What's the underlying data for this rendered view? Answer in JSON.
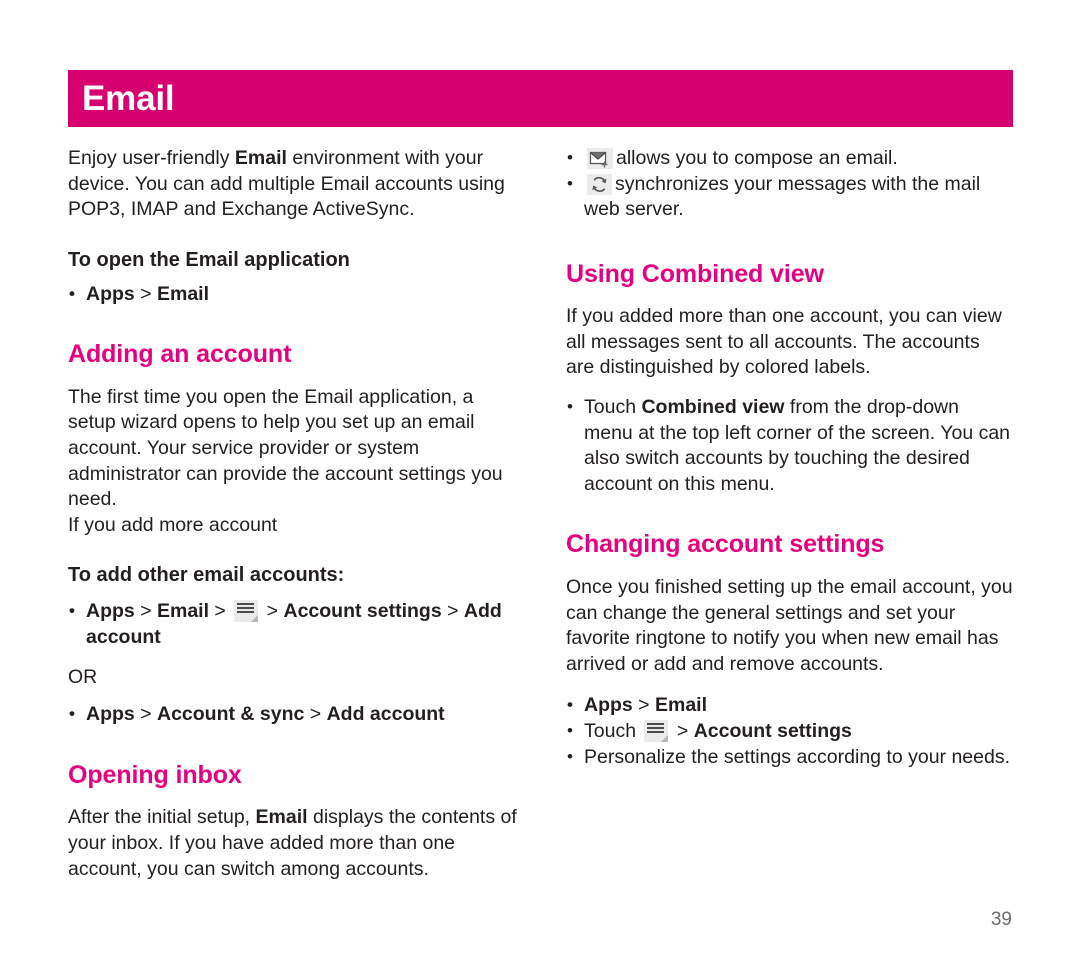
{
  "document": {
    "page_number": "39",
    "accent_band_color": "#d6006e",
    "heading_color": "#e5007e",
    "body_color": "#231f20"
  },
  "header": {
    "title": "Email"
  },
  "left_column": {
    "intro_paragraph": "Enjoy user-friendly Email environment with your device. You can add multiple Email accounts using POP3, IMAP and Exchange ActiveSync.",
    "intro_parts": {
      "p1": "Enjoy user-friendly ",
      "bold1": "Email",
      "p2": " environment with your device. You can add multiple Email accounts using POP3, IMAP and Exchange ActiveSync."
    },
    "open_app": {
      "subhead": "To open the Email application",
      "bullet": {
        "apps": "Apps",
        "sep": " > ",
        "email": "Email"
      }
    },
    "adding_account": {
      "heading": "Adding an account",
      "paragraph": "The first time you open the Email application, a setup wizard opens to help you set up an email account. Your service provider or system administrator can provide the account settings you need.",
      "paragraph_extra": "If you add more account"
    },
    "add_other": {
      "subhead": "To add other email accounts:",
      "bullet1": {
        "apps": "Apps",
        "sep1": " > ",
        "email": "Email",
        "sep2": " > ",
        "icon": "menu-icon",
        "sep3": " > ",
        "account_settings": "Account settings",
        "sep4": " > ",
        "add_account": "Add account"
      },
      "or_label": "OR",
      "bullet2": {
        "apps": "Apps",
        "sep1": " > ",
        "account_sync": "Account & sync",
        "sep2": " > ",
        "add_account": "Add account"
      }
    },
    "opening_inbox": {
      "heading": "Opening inbox",
      "paragraph_parts": {
        "p1": "After the initial setup, ",
        "bold1": "Email",
        "p2": " displays the contents of your inbox. If you have added more than one account, you can switch among accounts."
      }
    }
  },
  "right_column": {
    "icon_bullets": [
      {
        "icon": "compose-email-icon",
        "text": "allows you to compose an email."
      },
      {
        "icon": "sync-icon",
        "text": "synchronizes your messages with the mail web server."
      }
    ],
    "combined_view": {
      "heading": "Using Combined view",
      "paragraph": "If you added more than one account, you can view all messages sent to all accounts. The accounts are distinguished by colored labels.",
      "bullet_parts": {
        "p1": "Touch ",
        "bold1": "Combined view",
        "p2": " from the drop-down menu at the top left corner of the screen. You can also switch accounts by touching the desired account on this menu."
      }
    },
    "changing_settings": {
      "heading": "Changing account settings",
      "paragraph": "Once you finished setting up the email account, you can change the general settings and set your favorite ringtone to notify you when new email has arrived or add and remove accounts.",
      "bullets": {
        "b1": {
          "apps": "Apps",
          "sep": " > ",
          "email": "Email"
        },
        "b2": {
          "touch": "Touch ",
          "icon": "menu-icon",
          "sep": " > ",
          "account_settings": "Account settings"
        },
        "b3": {
          "text": "Personalize the settings according to your needs."
        }
      }
    }
  }
}
